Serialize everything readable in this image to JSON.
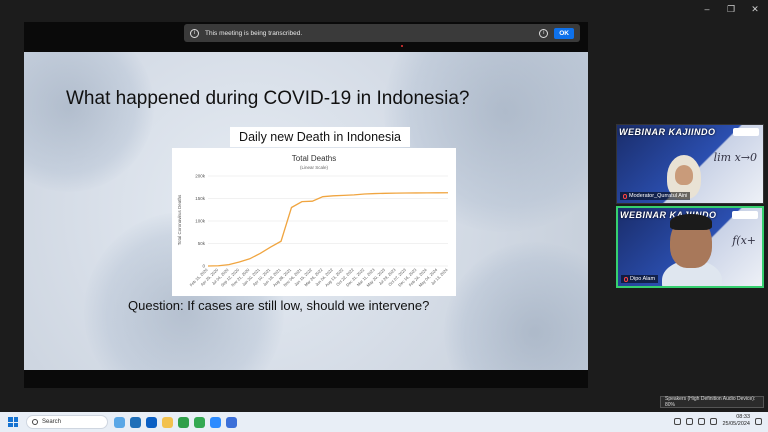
{
  "window": {
    "minimize": "–",
    "restore": "❐",
    "close": "✕"
  },
  "notice": {
    "message": "This meeting is being transcribed.",
    "ok_label": "OK"
  },
  "slide": {
    "title": "What happened during COVID-19 in Indonesia?",
    "chart_caption": "Daily new Death in Indonesia",
    "question": "Question: If cases are still low, should we intervene?"
  },
  "chart_data": {
    "type": "line",
    "title": "Total Deaths",
    "subtitle": "(Linear Scale)",
    "ylabel": "Total Coronavirus Deaths",
    "xlabel": "",
    "ylim": [
      0,
      200000
    ],
    "yticks": [
      "0",
      "50k",
      "100k",
      "150k",
      "200k"
    ],
    "x": [
      "Feb 15, 2020",
      "Apr 25, 2020",
      "Jul 04, 2020",
      "Sep 12, 2020",
      "Nov 21, 2020",
      "Jan 30, 2021",
      "Apr 10, 2021",
      "Jun 19, 2021",
      "Aug 28, 2021",
      "Nov 06, 2021",
      "Jan 15, 2022",
      "Mar 26, 2022",
      "Jun 04, 2022",
      "Aug 13, 2022",
      "Oct 22, 2022",
      "Dec 31, 2022",
      "Mar 11, 2023",
      "May 20, 2023",
      "Jul 29, 2023",
      "Oct 07, 2023",
      "Dec 16, 2023",
      "Feb 24, 2024",
      "May 04, 2024",
      "Jul 13, 2024"
    ],
    "series": [
      {
        "values": [
          0,
          500,
          3000,
          9000,
          16000,
          28000,
          42000,
          55000,
          130000,
          143000,
          144000,
          154000,
          156000,
          157000,
          158000,
          160000,
          161000,
          161500,
          162000,
          162200,
          162400,
          162500,
          162600,
          162700
        ]
      }
    ],
    "color": "#f0a540",
    "grid": true
  },
  "participants": [
    {
      "banner": "WEBINAR KAJIINDO",
      "name": "Moderator_Qurratul Aini",
      "math": "lim x→0"
    },
    {
      "banner": "WEBINAR KAJIINDO",
      "name": "Dipo Alam",
      "math": "f(x+"
    }
  ],
  "tooltip": "Speakers (High Definition Audio Device): 80%",
  "taskbar": {
    "search_placeholder": "Search",
    "time": "08:33",
    "date": "25/05/2024"
  }
}
